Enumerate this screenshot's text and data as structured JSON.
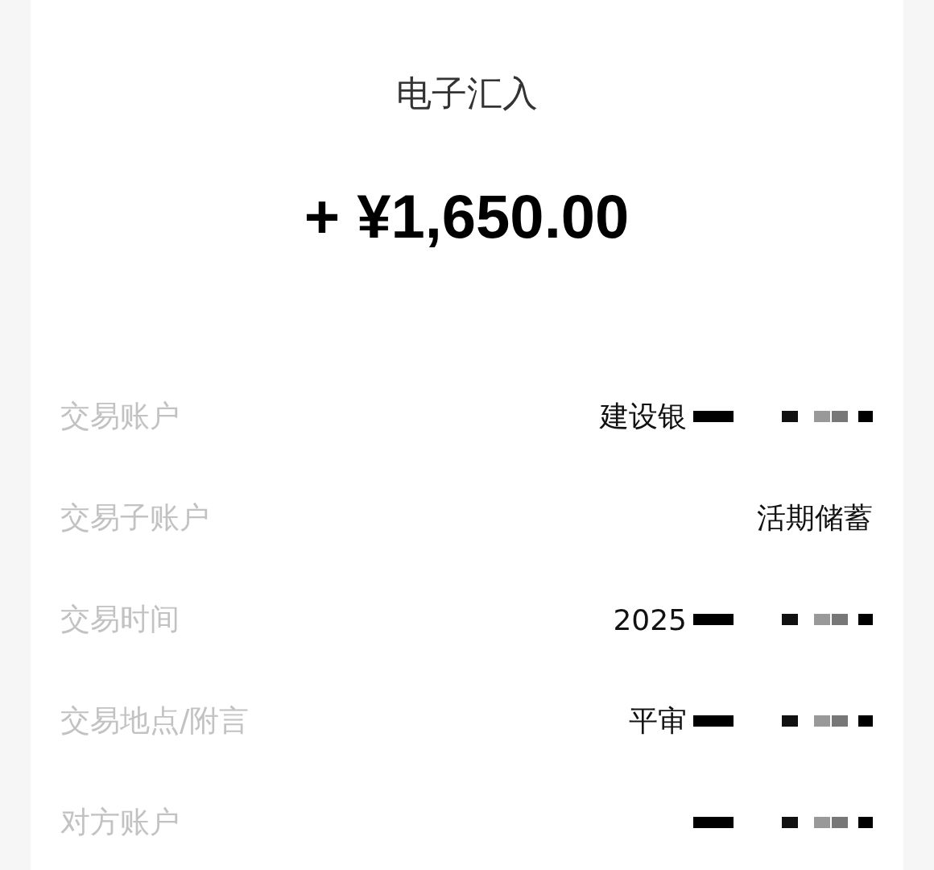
{
  "title": "电子汇入",
  "amount": "+ ¥1,650.00",
  "rows": [
    {
      "label": "交易账户",
      "value": "建设银",
      "redacted": true
    },
    {
      "label": "交易子账户",
      "value": "活期储蓄",
      "redacted": false
    },
    {
      "label": "交易时间",
      "value": "2025",
      "redacted": true
    },
    {
      "label": "交易地点/附言",
      "value": "平审",
      "redacted": true
    },
    {
      "label": "对方账户",
      "redacted": true
    }
  ]
}
